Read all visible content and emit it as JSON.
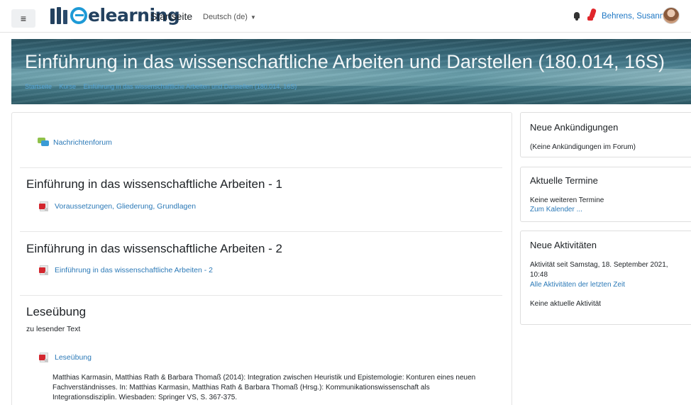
{
  "navbar": {
    "menu_icon": "hamburger-menu-icon",
    "logo_text": "elearning",
    "home_link": "Startseite",
    "language": "Deutsch (de)",
    "user_name": "Behrens, Susanne"
  },
  "header": {
    "title": "Einführung in das wissenschaftliche Arbeiten und Darstellen (180.014, 16S)",
    "breadcrumb": [
      "Startseite",
      "Kurse",
      "Einführung in das wissenschaftliche Arbeiten und Darstellen (180.014, 16S)"
    ]
  },
  "main": {
    "forum_link": "Nachrichtenforum",
    "sections": [
      {
        "title": "Einführung in das wissenschaftliche Arbeiten - 1",
        "resource": "Voraussetzungen, Gliederung, Grundlagen"
      },
      {
        "title": "Einführung in das wissenschaftliche Arbeiten - 2",
        "resource": "Einführung in das wissenschaftliche Arbeiten - 2"
      },
      {
        "title": "Leseübung",
        "summary": "zu lesender Text",
        "resource": "Leseübung",
        "citation": "Matthias Karmasin, Matthias Rath & Barbara Thomaß (2014): Integration zwischen Heuristik und Epistemologie: Konturen eines neuen Fachverständnisses. In: Matthias Karmasin, Matthias Rath & Barbara Thomaß (Hrsg.): Kommunikationswissenschaft als Integrationsdisziplin. Wiesbaden: Springer VS, S. 367-375."
      }
    ]
  },
  "blocks": {
    "news": {
      "title": "Neue Ankündigungen",
      "text": "(Keine Ankündigungen im Forum)"
    },
    "calendar": {
      "title": "Aktuelle Termine",
      "text": "Keine weiteren Termine",
      "link": "Zum Kalender ..."
    },
    "recent": {
      "title": "Neue Aktivitäten",
      "since_line1": "Aktivität seit Samstag, 18. September 2021,",
      "since_line2": "10:48",
      "link": "Alle Aktivitäten der letzten Zeit",
      "none": "Keine aktuelle Aktivität"
    }
  },
  "colors": {
    "link": "#2b79b7",
    "brand": "#23415f",
    "accent": "#1e9ad6",
    "pdf_red": "#d3262e"
  }
}
